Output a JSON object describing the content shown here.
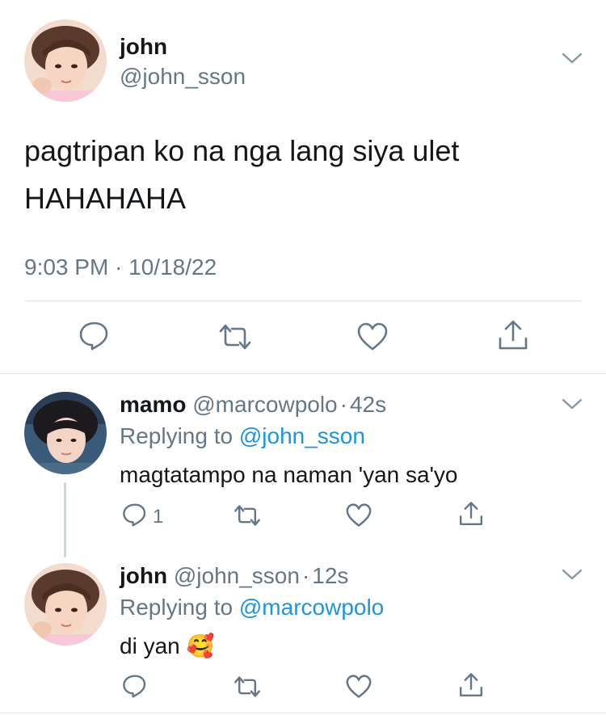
{
  "main_tweet": {
    "display_name": "john",
    "handle": "@john_sson",
    "text_line1": "pagtripan ko na nga lang siya ulet",
    "text_line2": "HAHAHAHA",
    "timestamp": "9:03 PM · 10/18/22"
  },
  "replies": [
    {
      "display_name": "mamo",
      "handle": "@marcowpolo",
      "separator": "·",
      "age": "42s",
      "replying_prefix": "Replying to",
      "replying_to": "@john_sson",
      "text": "magtatampo na naman 'yan sa'yo",
      "reply_count": "1"
    },
    {
      "display_name": "john",
      "handle": "@john_sson",
      "separator": "·",
      "age": "12s",
      "replying_prefix": "Replying to",
      "replying_to": "@marcowpolo",
      "text": "di yan",
      "emoji": "🥰"
    }
  ],
  "icons": {
    "reply": "reply-icon",
    "retweet": "retweet-icon",
    "like": "heart-icon",
    "share": "share-icon",
    "menu": "chevron-down-icon"
  },
  "colors": {
    "text": "#14171a",
    "muted": "#657786",
    "link": "#1b95e0",
    "divider": "#e1e8ed",
    "icon": "#657786"
  }
}
